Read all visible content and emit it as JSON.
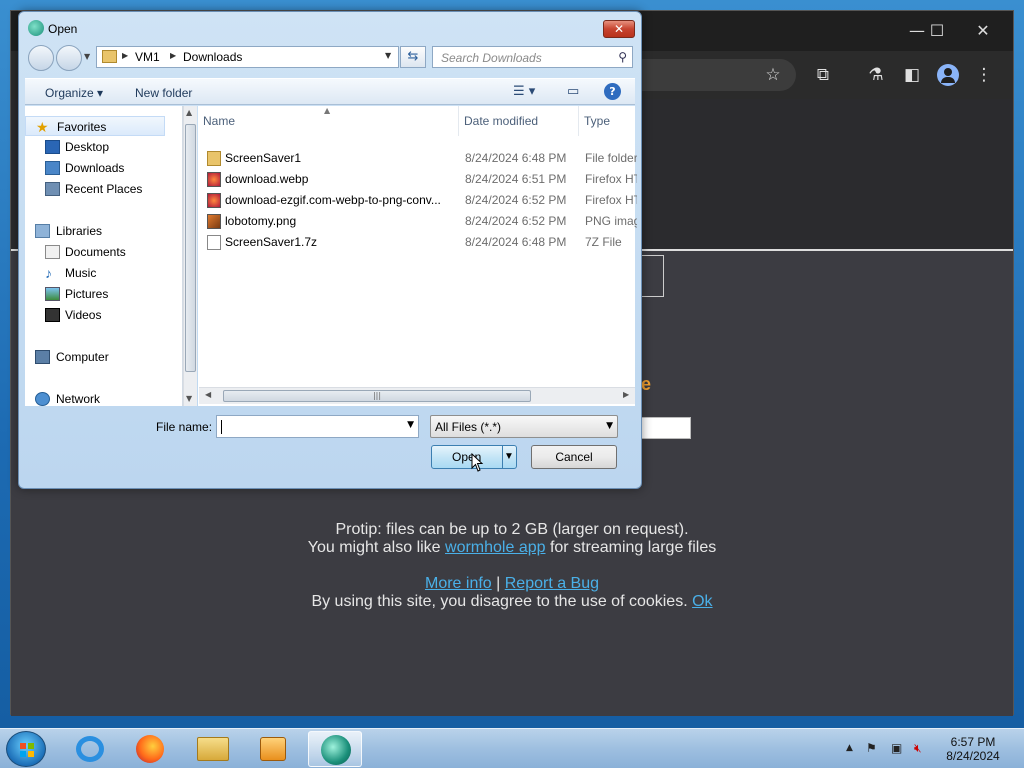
{
  "dialog": {
    "title": "Open",
    "close_label": "✕",
    "breadcrumb": [
      "VM1",
      "Downloads"
    ],
    "search_placeholder": "Search Downloads",
    "commands": {
      "organize": "Organize ▾",
      "new_folder": "New folder"
    },
    "nav": {
      "favorites": "Favorites",
      "desktop": "Desktop",
      "downloads": "Downloads",
      "recent": "Recent Places",
      "libraries": "Libraries",
      "documents": "Documents",
      "music": "Music",
      "pictures": "Pictures",
      "videos": "Videos",
      "computer": "Computer",
      "network": "Network"
    },
    "columns": {
      "name": "Name",
      "date": "Date modified",
      "type": "Type"
    },
    "files": [
      {
        "name": "ScreenSaver1",
        "date": "8/24/2024 6:48 PM",
        "type": "File folder",
        "icon": "folder-icon"
      },
      {
        "name": "download.webp",
        "date": "8/24/2024 6:51 PM",
        "type": "Firefox HTML",
        "icon": "firefox-file-icon"
      },
      {
        "name": "download-ezgif.com-webp-to-png-conv...",
        "date": "8/24/2024 6:52 PM",
        "type": "Firefox HTML",
        "icon": "firefox-file-icon"
      },
      {
        "name": "lobotomy.png",
        "date": "8/24/2024 6:52 PM",
        "type": "PNG image",
        "icon": "image-file-icon"
      },
      {
        "name": "ScreenSaver1.7z",
        "date": "8/24/2024 6:48 PM",
        "type": "7Z File",
        "icon": "blank-file-icon"
      }
    ],
    "file_name_label": "File name:",
    "file_name_value": "",
    "filter_value": "All Files (*.*)",
    "open_label": "Open",
    "cancel_label": "Cancel"
  },
  "page": {
    "protip": "Protip: files can be up to 2 GB (larger on request).",
    "also_prefix": "You might also like ",
    "wormhole_link": "wormhole app",
    "also_suffix": " for streaming large files",
    "more_info": "More info",
    "separator": " | ",
    "report_bug": "Report a Bug",
    "cookie_text": "By using this site, you disagree to the use of cookies. ",
    "ok_link": "Ok",
    "orange_fragment": "e"
  },
  "taskbar": {
    "time": "6:57 PM",
    "date": "8/24/2024"
  },
  "colors": {
    "accent": "#3c7fb1",
    "link": "#4ab0e8"
  }
}
